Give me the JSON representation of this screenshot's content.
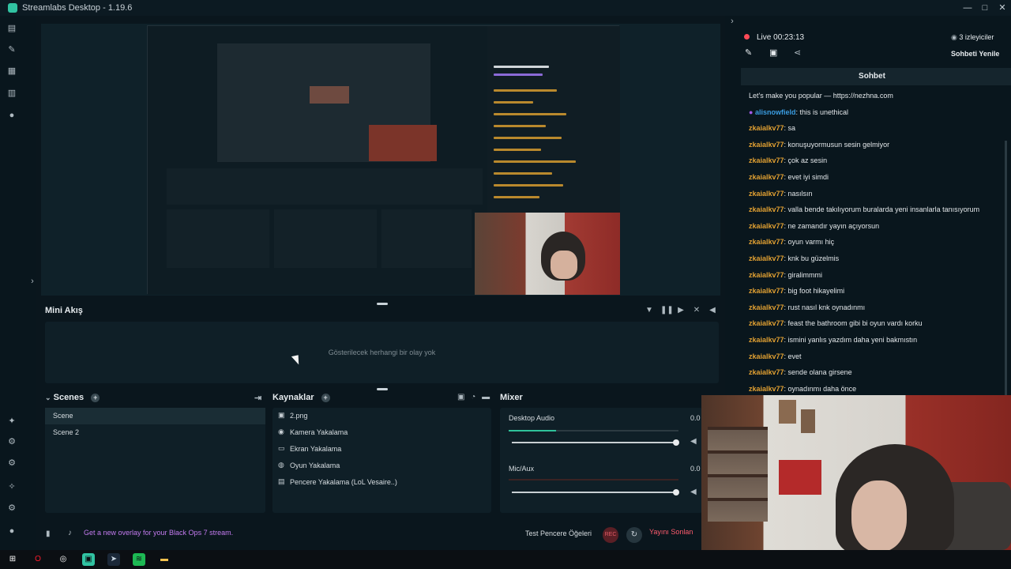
{
  "window": {
    "title": "Streamlabs Desktop - 1.19.6",
    "controls": [
      "—",
      "□",
      "✕"
    ]
  },
  "sidebar_icons": [
    "file-icon",
    "wrench-icon",
    "store-icon",
    "layout-icon",
    "record-icon"
  ],
  "sidebar_bottom_icons": [
    "puzzle-icon",
    "plug-icon",
    "plugin-icon",
    "sparkle-icon",
    "gear-icon",
    "user-icon"
  ],
  "mini_feed": {
    "title": "Mini Akış",
    "empty": "Gösterilecek herhangi bir olay yok"
  },
  "scenes": {
    "title": "Scenes",
    "items": [
      "Scene",
      "Scene 2"
    ]
  },
  "sources": {
    "title": "Kaynaklar",
    "items": [
      {
        "icon": "image-icon",
        "glyph": "▣",
        "label": "2.png"
      },
      {
        "icon": "camera-icon",
        "glyph": "◉",
        "label": "Kamera Yakalama"
      },
      {
        "icon": "monitor-icon",
        "glyph": "▭",
        "label": "Ekran Yakalama"
      },
      {
        "icon": "gamepad-icon",
        "glyph": "◍",
        "label": "Oyun Yakalama"
      },
      {
        "icon": "window-icon",
        "glyph": "▤",
        "label": "Pencere Yakalama (LoL Vesaire..)"
      }
    ]
  },
  "mixer": {
    "title": "Mixer",
    "channels": [
      {
        "name": "Desktop Audio",
        "value": "0.0",
        "level": 0.28
      },
      {
        "name": "Mic/Aux",
        "value": "0.0",
        "level": 0.0
      }
    ]
  },
  "footer": {
    "promo": "Get a new overlay for your Black Ops 7 stream.",
    "test_label": "Test Pencere Öğeleri",
    "rec_label": "REC",
    "live_label": "Yayını Sonlan"
  },
  "chat": {
    "live_label": "Live",
    "live_time": "00:23:13",
    "viewers": "3 izleyiciler",
    "title": "Sohbet",
    "refresh": "Sohbeti Yenile",
    "messages": [
      {
        "user": "",
        "text": "Let's make you popular — https://nezhna.com"
      },
      {
        "user": "alisnowfield",
        "text": ": this is unethical",
        "style": "blue"
      },
      {
        "user": "zkaialkv77",
        "text": ": sa"
      },
      {
        "user": "zkaialkv77",
        "text": ": konuşuyormusun sesin gelmiyor"
      },
      {
        "user": "zkaialkv77",
        "text": ": çok az sesin"
      },
      {
        "user": "zkaialkv77",
        "text": ": evet iyi simdi"
      },
      {
        "user": "zkaialkv77",
        "text": ": nasılsın"
      },
      {
        "user": "zkaialkv77",
        "text": ": valla bende takılıyorum buralarda yeni insanlarla tanısıyorum"
      },
      {
        "user": "zkaialkv77",
        "text": ": ne zamandır yayın açıyorsun"
      },
      {
        "user": "zkaialkv77",
        "text": ": oyun varmı hiç"
      },
      {
        "user": "zkaialkv77",
        "text": ": knk bu güzelmis"
      },
      {
        "user": "zkaialkv77",
        "text": ": giralimmmi"
      },
      {
        "user": "zkaialkv77",
        "text": ": big foot hikayelimi"
      },
      {
        "user": "zkaialkv77",
        "text": ": rust nasıl knk oynadınmı"
      },
      {
        "user": "zkaialkv77",
        "text": ": feast the bathroom gibi bi oyun vardı korku"
      },
      {
        "user": "zkaialkv77",
        "text": ": ismini yanlıs yazdım daha yeni bakmıstın"
      },
      {
        "user": "zkaialkv77",
        "text": ": evet"
      },
      {
        "user": "zkaialkv77",
        "text": ": sende olana girsene"
      },
      {
        "user": "zkaialkv77",
        "text": ": oynadınmı daha önce"
      }
    ]
  },
  "taskbar_icons": [
    {
      "name": "windows-start-icon",
      "glyph": "⊞",
      "color": "#ffffff",
      "bg": "transparent"
    },
    {
      "name": "opera-icon",
      "glyph": "O",
      "color": "#ff1b2d",
      "bg": "transparent"
    },
    {
      "name": "obs-icon",
      "glyph": "◎",
      "color": "#ffffff",
      "bg": "transparent"
    },
    {
      "name": "streamlabs-icon",
      "glyph": "▣",
      "color": "#0b0f13",
      "bg": "#31c3a2"
    },
    {
      "name": "steam-icon",
      "glyph": "➤",
      "color": "#c7d5e0",
      "bg": "#1b2838"
    },
    {
      "name": "spotify-icon",
      "glyph": "≋",
      "color": "#0b0f13",
      "bg": "#1db954"
    },
    {
      "name": "folder-icon",
      "glyph": "▬",
      "color": "#f2c14e",
      "bg": "transparent"
    }
  ],
  "colors": {
    "accent": "#31c3a2",
    "live_red": "#ff5c6e",
    "chat_user": "#e1a032",
    "promo_purple": "#c47bf0"
  }
}
